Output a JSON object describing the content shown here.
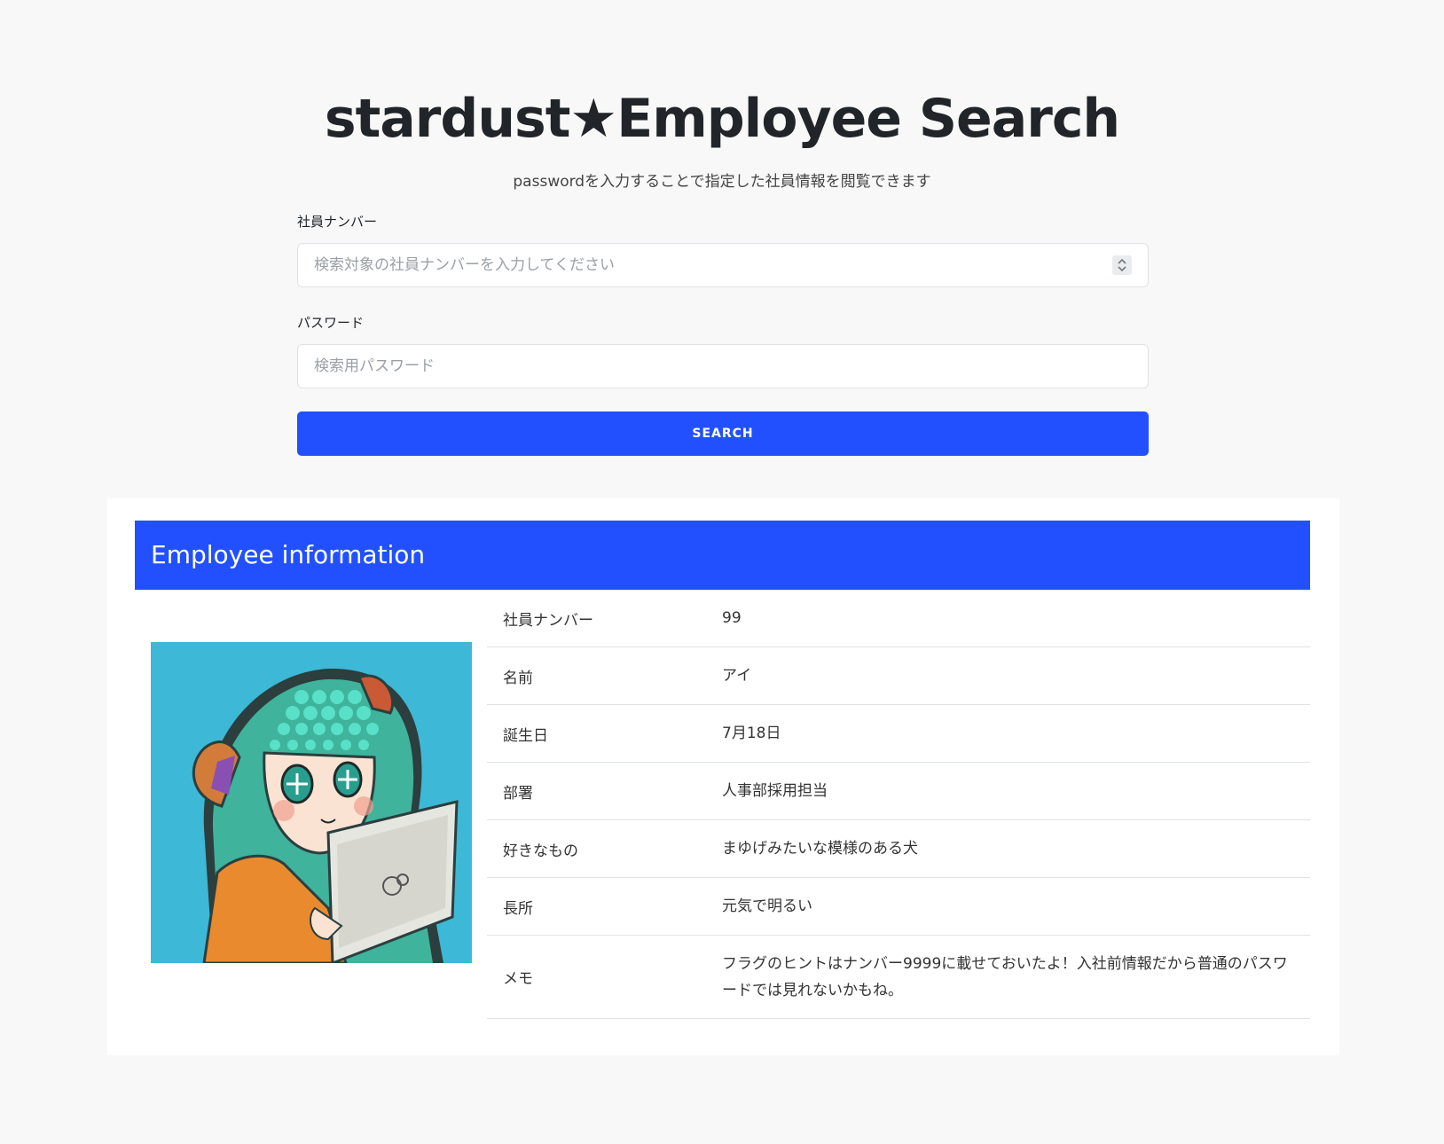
{
  "header": {
    "title": "stardust★Employee Search",
    "subtitle": "passwordを入力することで指定した社員情報を閲覧できます"
  },
  "form": {
    "employee_number_label": "社員ナンバー",
    "employee_number_placeholder": "検索対象の社員ナンバーを入力してください",
    "password_label": "パスワード",
    "password_placeholder": "検索用パスワード",
    "search_button": "SEARCH"
  },
  "employee_card": {
    "heading": "Employee information",
    "rows": [
      {
        "key": "社員ナンバー",
        "value": "99"
      },
      {
        "key": "名前",
        "value": "アイ"
      },
      {
        "key": "誕生日",
        "value": "7月18日"
      },
      {
        "key": "部署",
        "value": "人事部採用担当"
      },
      {
        "key": "好きなもの",
        "value": "まゆげみたいな模様のある犬"
      },
      {
        "key": "長所",
        "value": "元気で明るい"
      },
      {
        "key": "メモ",
        "value": "フラグのヒントはナンバー9999に載せておいたよ！入社前情報だから普通のパスワードでは見れないかもね。"
      }
    ]
  },
  "colors": {
    "accent": "#2250ff",
    "page_background": "#f8f8f8",
    "avatar_background": "#3db8d6"
  }
}
